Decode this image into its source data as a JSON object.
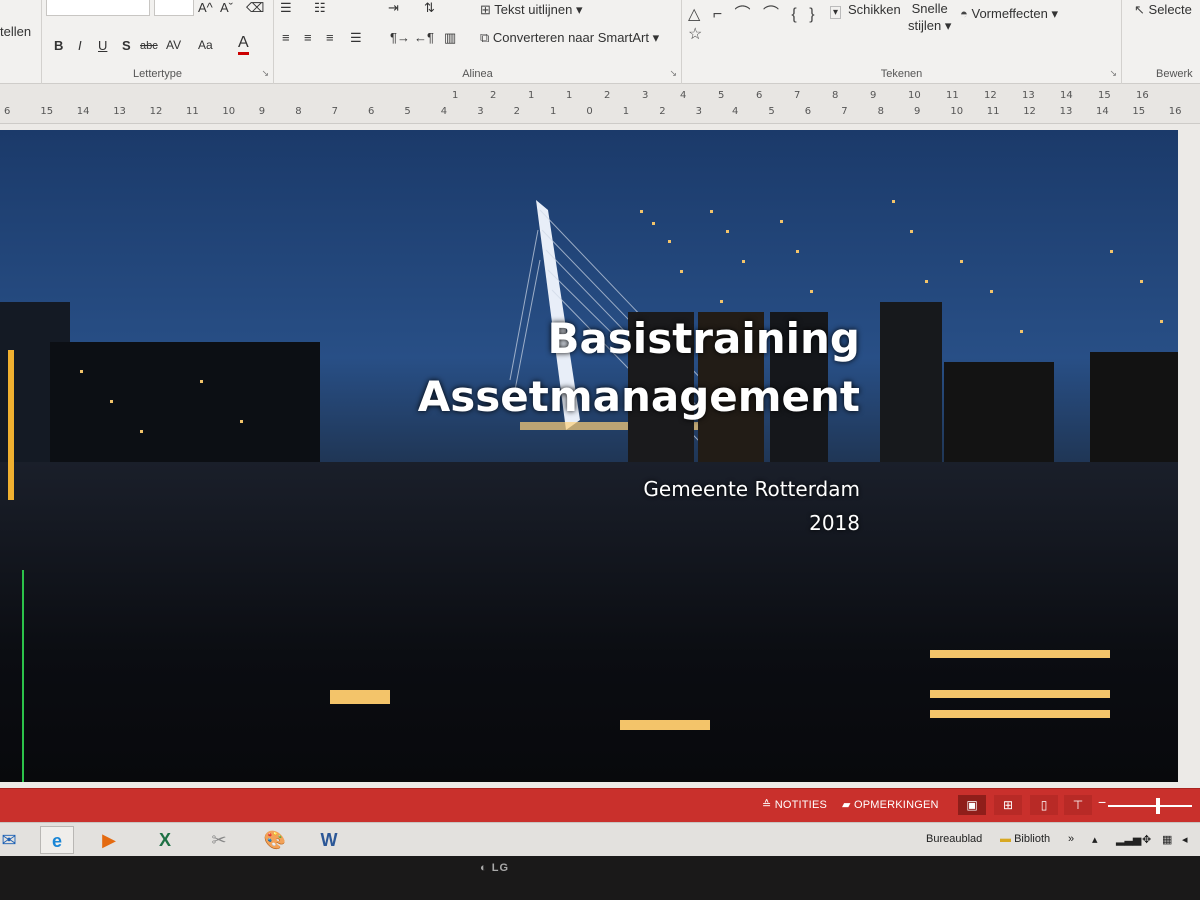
{
  "ribbon": {
    "left_partial": "tellen",
    "font_group_label": "Lettertype",
    "bold": "B",
    "italic": "I",
    "underline": "U",
    "strike": "S",
    "strikethrough_abbr": "abc",
    "char_spacing": "AV",
    "change_case": "Aa",
    "font_color": "A",
    "paragraph_group_label": "Alinea",
    "align_text": "Tekst uitlijnen",
    "convert_smartart": "Converteren naar SmartArt",
    "drawing_group_label": "Tekenen",
    "arrange": "Schikken",
    "quick_styles_line1": "Snelle",
    "quick_styles_line2": "stijlen",
    "shape_effects": "Vormeffecten",
    "select": "Selecte",
    "editing_group_label": "Bewerk"
  },
  "ruler": {
    "top_ticks": [
      "1",
      "2",
      "1",
      "1",
      "2",
      "3",
      "4",
      "5",
      "6",
      "7",
      "8",
      "9",
      "10",
      "11",
      "12",
      "13",
      "14",
      "15",
      "16"
    ],
    "left_ticks": [
      "6",
      "15",
      "14",
      "13",
      "12",
      "11",
      "10",
      "9",
      "8",
      "7",
      "6",
      "5",
      "4",
      "3",
      "2",
      "1",
      "0",
      "1",
      "2",
      "3",
      "4",
      "5",
      "6",
      "7",
      "8",
      "9",
      "10",
      "11",
      "12",
      "13",
      "14",
      "15",
      "16"
    ]
  },
  "slide": {
    "title_line1": "Basistraining",
    "title_line2": "Assetmanagement",
    "subtitle_line1": "Gemeente Rotterdam",
    "subtitle_line2": "2018"
  },
  "statusbar": {
    "notes": "NOTITIES",
    "comments": "OPMERKINGEN",
    "accent_color": "#c9302c"
  },
  "taskbar": {
    "apps": [
      "outlook-icon",
      "internet-explorer-icon",
      "media-player-icon",
      "excel-icon",
      "snipping-tool-icon",
      "paint-icon",
      "word-icon"
    ],
    "tray_desktop": "Bureaublad",
    "tray_library": "Biblioth",
    "tray_more": "»"
  },
  "monitor": {
    "brand": "LG"
  }
}
